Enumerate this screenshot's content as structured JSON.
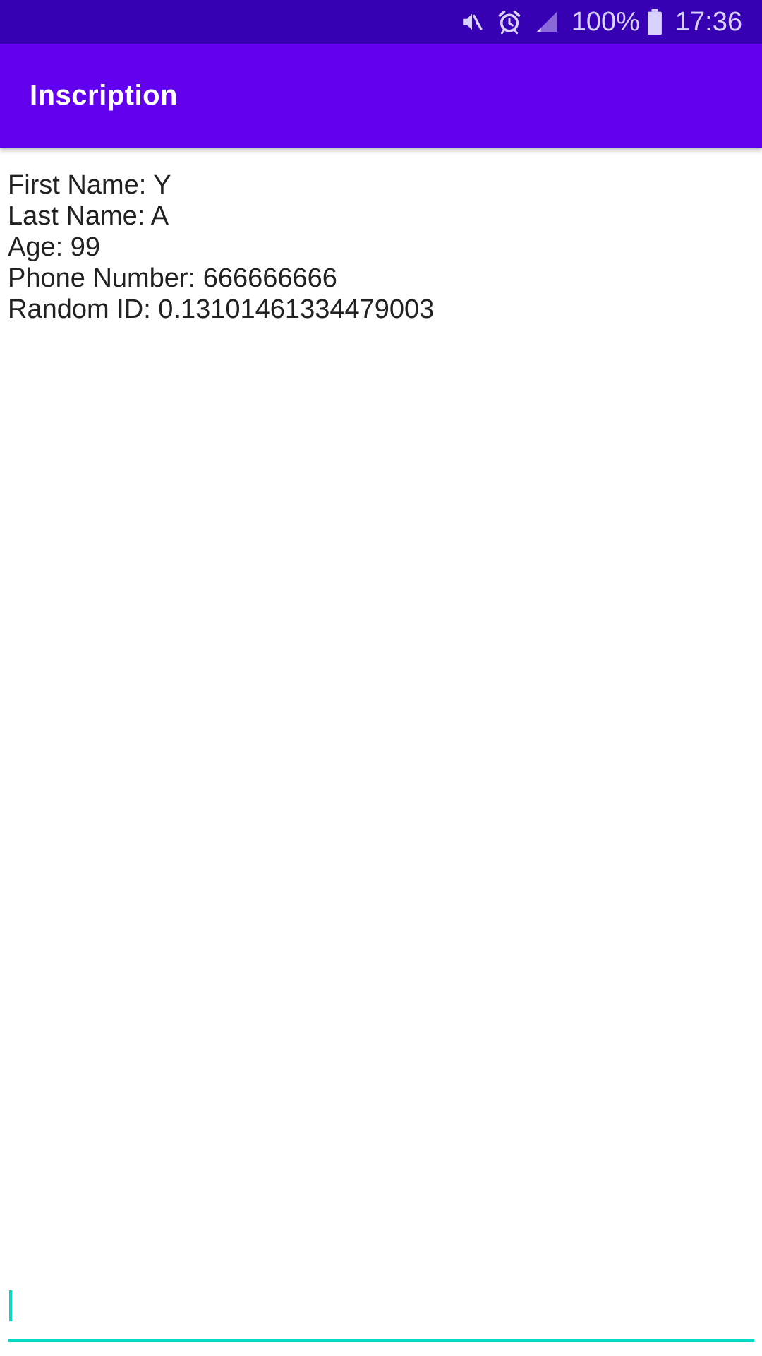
{
  "status_bar": {
    "battery_percent": "100%",
    "time": "17:36",
    "icons": [
      "mute-icon",
      "alarm-icon",
      "signal-icon",
      "battery-icon"
    ],
    "background_color": "#3700B3"
  },
  "app_bar": {
    "title": "Inscription",
    "background_color": "#6200EE"
  },
  "details": {
    "first_name": "First Name: Y",
    "last_name": "Last Name: A",
    "age": "Age: 99",
    "phone_number": "Phone Number: 666666666",
    "random_id": "Random ID: 0.13101461334479003"
  },
  "input": {
    "value": "",
    "accent_color": "#03DAC5"
  }
}
